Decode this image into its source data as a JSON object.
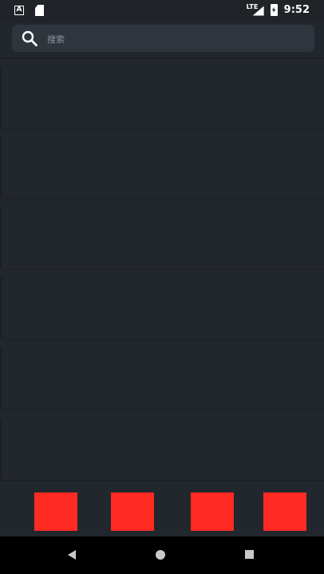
{
  "status_bar": {
    "network": "LTE",
    "time": "9:52"
  },
  "search": {
    "placeholder": "搜索",
    "value": ""
  },
  "list": {
    "items": [
      {},
      {},
      {},
      {},
      {},
      {}
    ]
  },
  "tabs": [
    {
      "icon": "tab-icon-1",
      "color": "#ff2a22",
      "label": ""
    },
    {
      "icon": "tab-icon-2",
      "color": "#ff2a22",
      "label": ""
    },
    {
      "icon": "tab-icon-3",
      "color": "#ff2a22",
      "label": ""
    },
    {
      "icon": "tab-icon-4",
      "color": "#ff2a22",
      "label": ""
    }
  ],
  "navigation": {
    "back": "back-icon",
    "home": "home-icon",
    "recents": "recents-icon"
  },
  "colors": {
    "background": "#22272d",
    "accent": "#ff2a22",
    "search_box": "#2e353d"
  }
}
